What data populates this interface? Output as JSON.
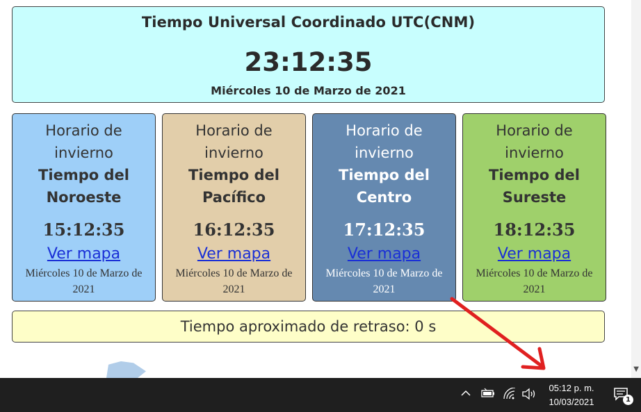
{
  "utc": {
    "title": "Tiempo Universal Coordinado UTC(CNM)",
    "time": "23:12:35",
    "date": "Miércoles 10 de Marzo de 2021"
  },
  "zones": [
    {
      "season": "Horario de invierno",
      "name": "Tiempo del Noroeste",
      "time": "15:12:35",
      "link": "Ver mapa",
      "date": "Miércoles 10 de Marzo de 2021",
      "color": "#9ecff8"
    },
    {
      "season": "Horario de invierno",
      "name": "Tiempo del Pacífico",
      "time": "16:12:35",
      "link": "Ver mapa",
      "date": "Miércoles 10 de Marzo de 2021",
      "color": "#e2ceaa"
    },
    {
      "season": "Horario de invierno",
      "name": "Tiempo del Centro",
      "time": "17:12:35",
      "link": "Ver mapa",
      "date": "Miércoles 10 de Marzo de 2021",
      "color": "#6589b0"
    },
    {
      "season": "Horario de invierno",
      "name": "Tiempo del Sureste",
      "time": "18:12:35",
      "link": "Ver mapa",
      "date": "Miércoles 10 de Marzo de 2021",
      "color": "#9fd06b"
    }
  ],
  "delay": {
    "text": "Tiempo aproximado de retraso: 0 s"
  },
  "taskbar": {
    "clock_time": "05:12 p. m.",
    "clock_date": "10/03/2021",
    "notification_count": "1",
    "icons": [
      "chevron-up-icon",
      "battery-icon",
      "wifi-icon",
      "volume-icon",
      "notification-icon"
    ]
  },
  "colors": {
    "utc_bg": "#c8fefe",
    "delay_bg": "#fefec8",
    "link": "#1a2fd6",
    "arrow": "#e02020",
    "taskbar": "#1f1f1f"
  }
}
